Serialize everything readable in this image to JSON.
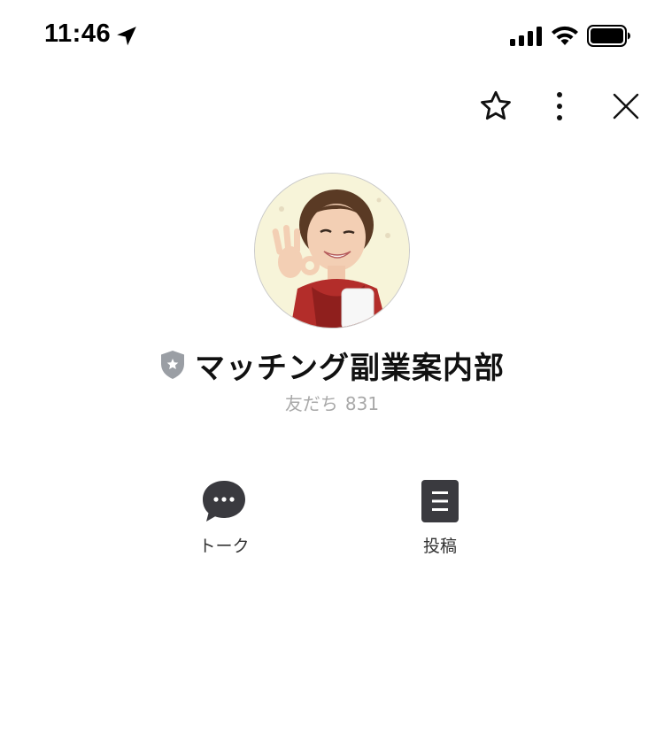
{
  "status_bar": {
    "time": "11:46",
    "icons": [
      "location-arrow-icon",
      "signal-bars-icon",
      "wifi-icon",
      "battery-icon"
    ]
  },
  "top_actions": {
    "icons": [
      "star-outline-icon",
      "more-vertical-icon",
      "close-icon"
    ]
  },
  "profile": {
    "name": "マッチング副業案内部",
    "badge_icon": "gray-shield-star-icon",
    "friends_label": "友だち",
    "friends_count": "831"
  },
  "actions": {
    "talk_label": "トーク",
    "talk_icon": "chat-bubble-icon",
    "post_label": "投稿",
    "post_icon": "document-icon"
  },
  "colors": {
    "icon_dark": "#3a3a3f",
    "badge_gray": "#9a9ea4",
    "subtext_gray": "#a9a9a9"
  }
}
